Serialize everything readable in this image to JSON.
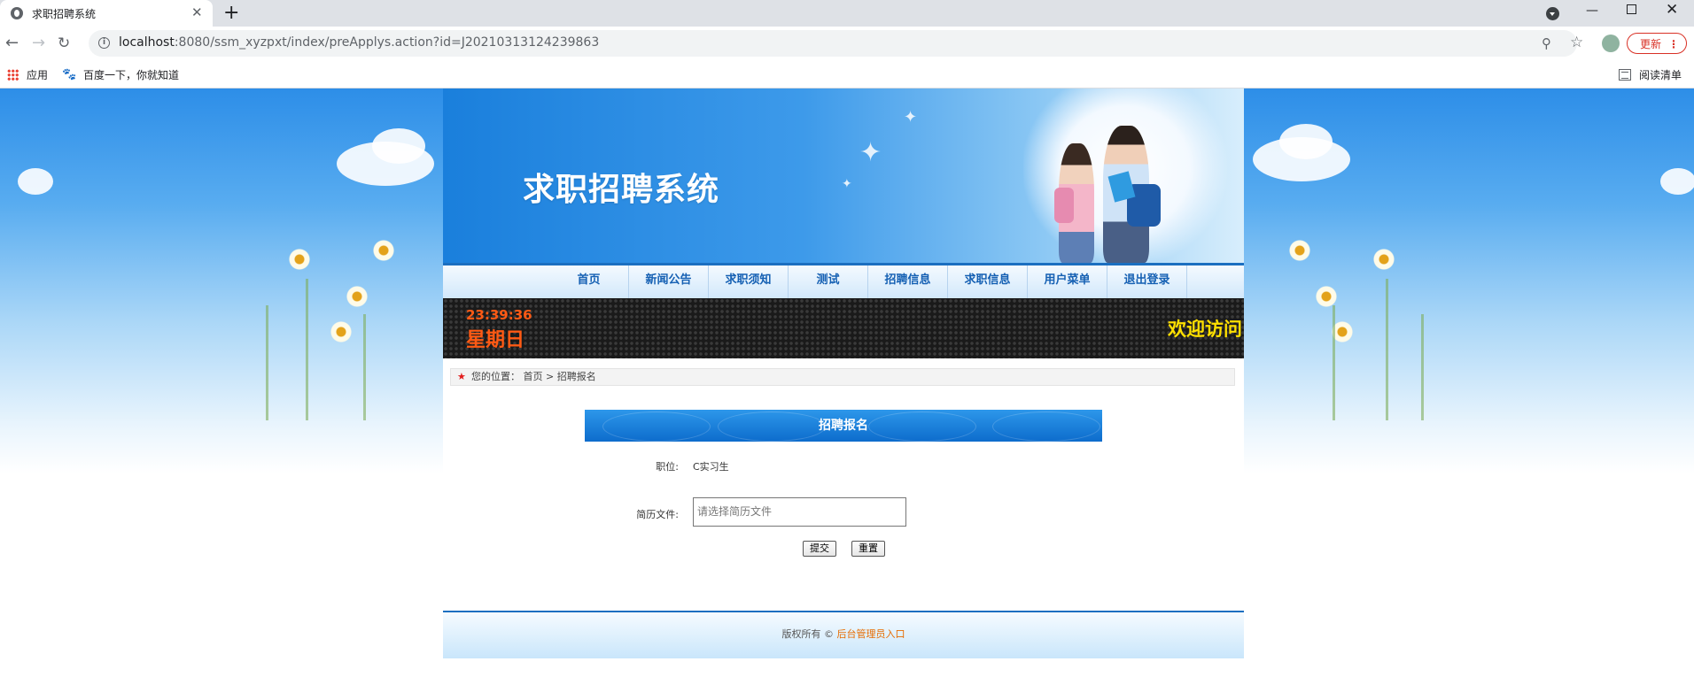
{
  "browser": {
    "tab_title": "求职招聘系统",
    "tab_close": "✕",
    "new_tab": "+",
    "url_host": "localhost",
    "url_rest": ":8080/ssm_xyzpxt/index/preApplys.action?id=J20210313124239863",
    "update_label": "更新",
    "bookmarks": {
      "apps_label": "应用",
      "baidu_label": "百度一下，你就知道",
      "reading_list_label": "阅读清单"
    }
  },
  "site": {
    "banner_title": "求职招聘系统",
    "menu": [
      "首页",
      "新闻公告",
      "求职须知",
      "测试",
      "招聘信息",
      "求职信息",
      "用户菜单",
      "退出登录"
    ],
    "led": {
      "time": "23:39:36",
      "weekday": "星期日",
      "marquee": "欢迎访问"
    },
    "breadcrumb": {
      "prefix": "您的位置：",
      "home": "首页",
      "separator": ">",
      "current": "招聘报名"
    },
    "form": {
      "title": "招聘报名",
      "position_label": "职位:",
      "position_value": "C实习生",
      "resume_label": "简历文件:",
      "resume_placeholder": "请选择简历文件",
      "submit_label": "提交",
      "reset_label": "重置"
    },
    "footer": {
      "copyright": "版权所有 ©",
      "admin_link": "后台管理员入口"
    }
  },
  "colors": {
    "menu_text": "#1560b3",
    "led_orange": "#ff5a14",
    "led_yellow": "#ffe000",
    "header_blue": "#0d6ccc",
    "admin_link": "#e66b00",
    "update_red": "#d93025"
  },
  "icons": [
    "globe-icon",
    "close-icon",
    "plus-icon",
    "back-arrow-icon",
    "forward-arrow-icon",
    "reload-icon",
    "info-icon",
    "zoom-icon",
    "star-icon",
    "apps-icon",
    "baidu-icon",
    "reading-list-icon",
    "red-star-icon"
  ]
}
